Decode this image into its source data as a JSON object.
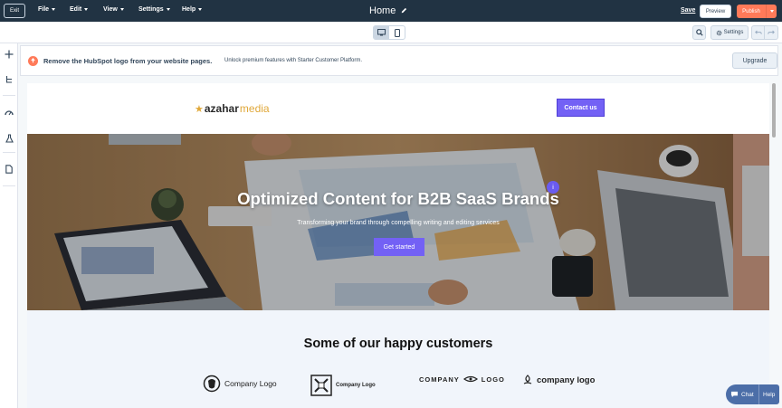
{
  "topbar": {
    "exit_label": "Exit",
    "menu": [
      {
        "label": "File"
      },
      {
        "label": "Edit"
      },
      {
        "label": "View"
      },
      {
        "label": "Settings"
      },
      {
        "label": "Help"
      }
    ],
    "page_title": "Home",
    "save_label": "Save",
    "preview_label": "Preview",
    "publish_label": "Publish"
  },
  "toolbar": {
    "settings_label": "Settings",
    "device_active": "desktop"
  },
  "banner": {
    "title": "Remove the HubSpot logo from your website pages.",
    "description": "Unlock premium features with Starter Customer Platform.",
    "upgrade_label": "Upgrade"
  },
  "site": {
    "logo_part1": "azahar",
    "logo_part2": "media",
    "contact_label": "Contact us",
    "hero": {
      "title": "Optimized Content for B2B SaaS Brands",
      "subtitle": "Transforming your brand through compelling writing and editing services",
      "cta_label": "Get started",
      "info_marker": "i"
    },
    "customers": {
      "title": "Some of our happy customers",
      "logos": [
        {
          "text": "Company Logo"
        },
        {
          "text": "Company Logo"
        },
        {
          "text": "COMPANY",
          "text2": "LOGO"
        },
        {
          "text": "company logo"
        }
      ]
    }
  },
  "chat": {
    "chat_label": "Chat",
    "help_label": "Help"
  },
  "colors": {
    "topbar": "#213343",
    "accent_orange": "#ff7a59",
    "brand_purple": "#7361f5",
    "logo_gold": "#e0a83a"
  }
}
